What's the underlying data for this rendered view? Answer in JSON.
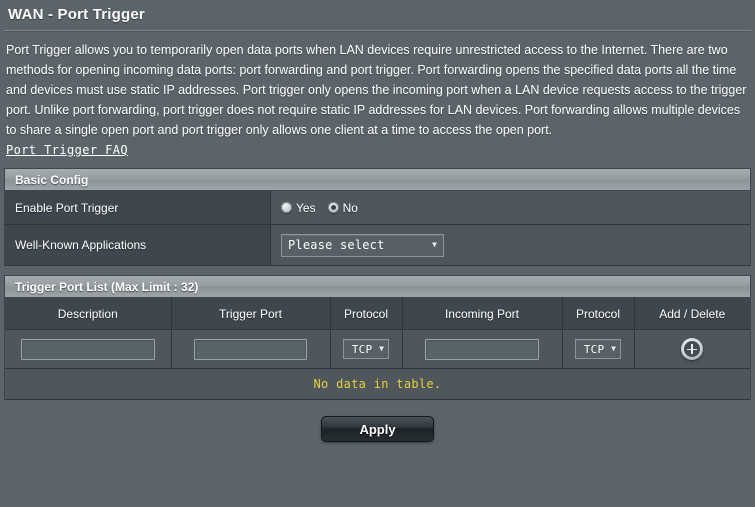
{
  "page": {
    "title": "WAN - Port Trigger",
    "description": "Port Trigger allows you to temporarily open data ports when LAN devices require unrestricted access to the Internet. There are two methods for opening incoming data ports: port forwarding and port trigger. Port forwarding opens the specified data ports all the time and devices must use static IP addresses. Port trigger only opens the incoming port when a LAN device requests access to the trigger port. Unlike port forwarding, port trigger does not require static IP addresses for LAN devices. Port forwarding allows multiple devices to share a single open port and port trigger only allows one client at a time to access the open port.",
    "faq_link": "Port Trigger FAQ"
  },
  "basic_config": {
    "header": "Basic Config",
    "enable_port_trigger": {
      "label": "Enable Port Trigger",
      "options": [
        "Yes",
        "No"
      ],
      "yes_label": "Yes",
      "no_label": "No",
      "selected": "No"
    },
    "well_known_applications": {
      "label": "Well-Known Applications",
      "selected": "Please select"
    }
  },
  "trigger_port_list": {
    "header": "Trigger Port List (Max Limit : 32)",
    "columns": [
      "Description",
      "Trigger Port",
      "Protocol",
      "Incoming Port",
      "Protocol",
      "Add / Delete"
    ],
    "new_row": {
      "description_value": "",
      "description_placeholder": "",
      "trigger_port_value": "",
      "trigger_port_placeholder": "",
      "trigger_protocol": "TCP",
      "incoming_port_value": "",
      "incoming_port_placeholder": "",
      "incoming_protocol": "TCP",
      "add_icon": "plus-circle-icon"
    },
    "empty_message": "No data in table."
  },
  "footer": {
    "apply_label": "Apply"
  },
  "colors": {
    "page_bg": "#5b6569",
    "panel_bg": "#4d575c",
    "label_bg": "#3e474d",
    "section_head": "#9aa2a6",
    "warning_text": "#e8cf3a",
    "border": "#2f373b"
  }
}
